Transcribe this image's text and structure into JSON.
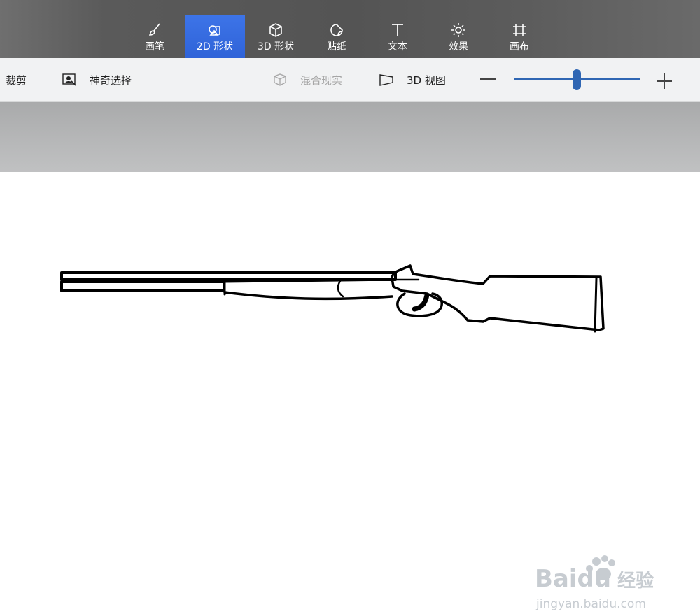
{
  "ribbon": {
    "tabs": [
      {
        "label": "画笔",
        "icon": "brush-icon",
        "active": false
      },
      {
        "label": "2D 形状",
        "icon": "2d-shapes-icon",
        "active": true
      },
      {
        "label": "3D 形状",
        "icon": "3d-cube-icon",
        "active": false
      },
      {
        "label": "贴纸",
        "icon": "sticker-icon",
        "active": false
      },
      {
        "label": "文本",
        "icon": "text-icon",
        "active": false
      },
      {
        "label": "效果",
        "icon": "sun-effects-icon",
        "active": false
      },
      {
        "label": "画布",
        "icon": "canvas-crop-icon",
        "active": false
      }
    ],
    "active_color": "#3569e0"
  },
  "commandbar": {
    "crop_label": "裁剪",
    "magic_select_label": "神奇选择",
    "mixed_reality_label": "混合现实",
    "view3d_label": "3D 视图",
    "zoom_level": 0.5
  },
  "watermark": {
    "brand": "Baidu",
    "cn": "经验",
    "url": "jingyan.baidu.com"
  }
}
